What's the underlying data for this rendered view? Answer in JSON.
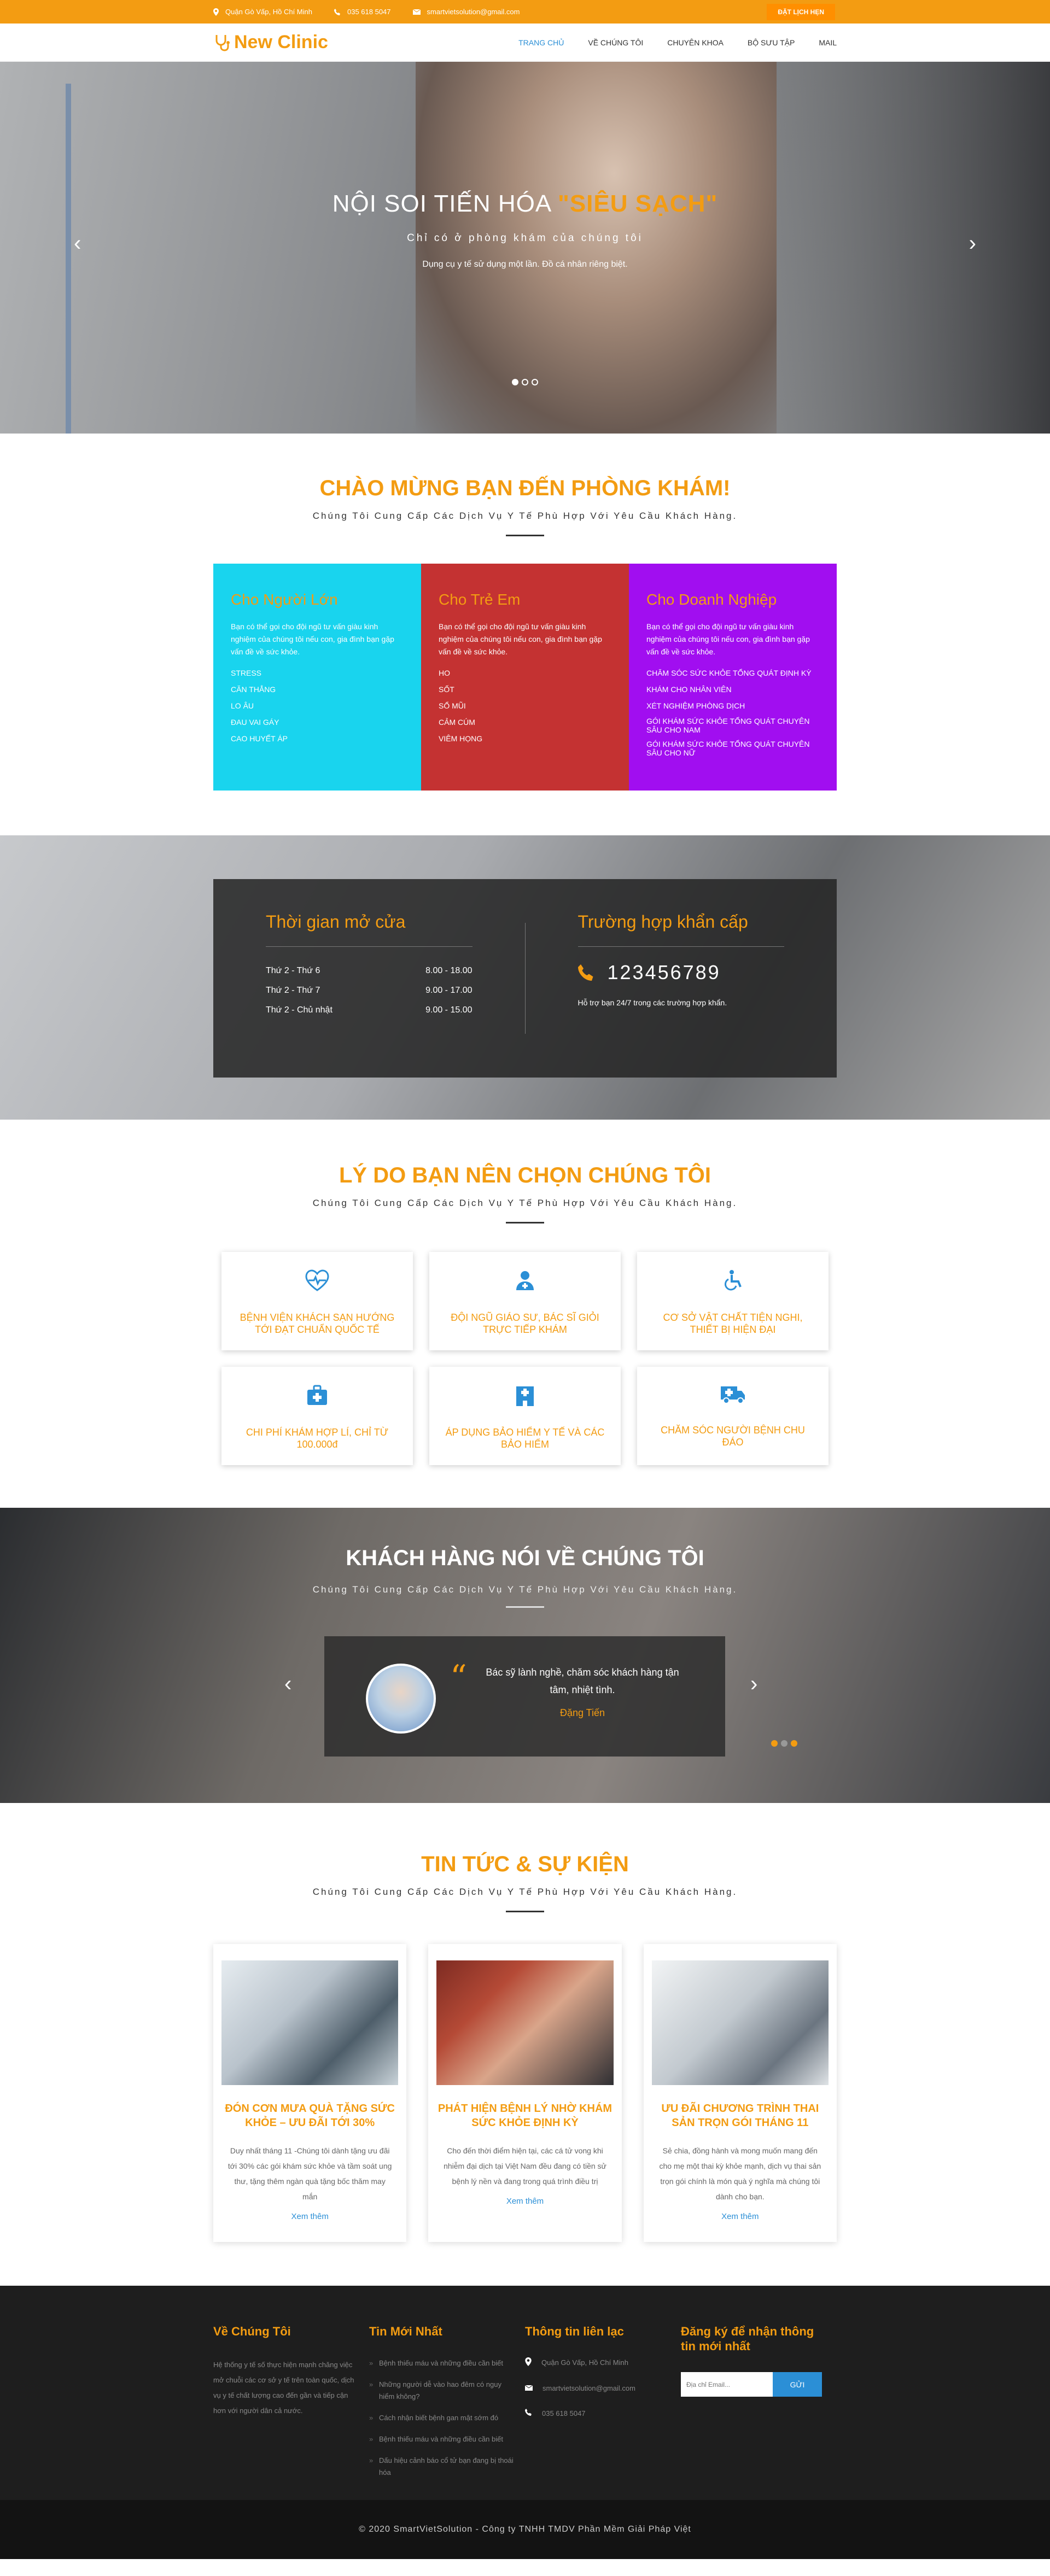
{
  "topbar": {
    "address": "Quận Gò Vấp, Hồ Chí Minh",
    "phone": "035 618 5047",
    "email": "smartvietsolution@gmail.com",
    "cta": "ĐẶT LỊCH HẸN"
  },
  "logo": {
    "text": "New Clinic"
  },
  "menu": [
    {
      "label": "TRANG CHỦ"
    },
    {
      "label": "VỀ CHÚNG TÔI"
    },
    {
      "label": "CHUYÊN KHOA"
    },
    {
      "label": "BỘ SƯU TẬP"
    },
    {
      "label": "MAIL"
    }
  ],
  "hero": {
    "title_prefix": "NỘI SOI TIẾN HÓA",
    "title_highlight": "\"SIÊU SẠCH\"",
    "subtitle": "Chỉ có ở phòng khám của chúng tôi",
    "text": "Dụng cụ y tế sử dụng một lần. Đồ cá nhân riêng biệt."
  },
  "welcome": {
    "title": "CHÀO MỪNG BẠN ĐẾN PHÒNG KHÁM!",
    "subtitle": "Chúng Tôi Cung Cấp Các Dịch Vụ Y Tế Phù Hợp Với Yêu Cầu Khách Hàng."
  },
  "services": [
    {
      "title": "Cho Người Lớn",
      "desc": "Bạn có thể gọi cho đội ngũ tư vấn giàu kinh nghiệm của chúng tôi nếu con, gia đình bạn gặp vấn đề về sức khỏe.",
      "items": [
        "STRESS",
        "CĂN THẲNG",
        "LO ÂU",
        "ĐAU VAI GÁY",
        "CAO HUYẾT ÁP"
      ],
      "color": "#19d4ee"
    },
    {
      "title": "Cho Trẻ Em",
      "desc": "Bạn có thể gọi cho đội ngũ tư vấn giàu kinh nghiệm của chúng tôi nếu con, gia đình bạn gặp vấn đề về sức khỏe.",
      "items": [
        "HO",
        "SỐT",
        "SỔ MŨI",
        "CẢM CÚM",
        "VIÊM HỌNG"
      ],
      "color": "#c43232"
    },
    {
      "title": "Cho Doanh Nghiệp",
      "desc": "Bạn có thể gọi cho đội ngũ tư vấn giàu kinh nghiệm của chúng tôi nếu con, gia đình bạn gặp vấn đề về sức khỏe.",
      "items": [
        "CHĂM SÓC SỨC KHỎE TỔNG QUÁT ĐỊNH KỲ",
        "KHÁM CHO NHÂN VIÊN",
        "XÉT NGHIỆM PHÒNG DỊCH",
        "GÓI KHÁM SỨC KHỎE TỔNG QUÁT CHUYÊN SÂU CHO NAM",
        "GÓI KHÁM SỨC KHỎE TỔNG QUÁT CHUYÊN SÂU CHO NỮ"
      ],
      "color": "#a10ef0"
    }
  ],
  "hours": {
    "title": "Thời gian mở cửa",
    "rows": [
      {
        "day": "Thứ 2 - Thứ 6",
        "time": "8.00 - 18.00"
      },
      {
        "day": "Thứ 2 - Thứ 7",
        "time": "9.00 - 17.00"
      },
      {
        "day": "Thứ 2 - Chủ nhật",
        "time": "9.00 - 15.00"
      }
    ]
  },
  "emergency": {
    "title": "Trường hợp khẩn cấp",
    "phone": "123456789",
    "note": "Hỗ trợ bạn 24/7 trong các trường hợp khẩn."
  },
  "why": {
    "title": "LÝ DO BẠN NÊN CHỌN CHÚNG TÔI",
    "subtitle": "Chúng Tôi Cung Cấp Các Dịch Vụ Y Tế Phù Hợp Với Yêu Cầu Khách Hàng.",
    "items": [
      {
        "icon": "heart-pulse-icon",
        "text": "BỆNH VIỆN KHÁCH SẠN HƯỚNG TỚI ĐẠT CHUẨN QUỐC TẾ"
      },
      {
        "icon": "doctor-icon",
        "text": "ĐỘI NGŨ GIÁO SƯ, BÁC SĨ GIỎI TRỰC TIẾP KHÁM"
      },
      {
        "icon": "wheelchair-icon",
        "text": "CƠ SỞ VẬT CHẤT TIỆN NGHI, THIẾT BỊ HIỆN ĐẠI"
      },
      {
        "icon": "medkit-icon",
        "text": "CHI PHÍ KHÁM HỢP LÍ, CHỈ TỪ 100.000đ"
      },
      {
        "icon": "hospital-icon",
        "text": "ÁP DỤNG BẢO HIỂM Y TẾ VÀ CÁC BẢO HIỂM"
      },
      {
        "icon": "ambulance-icon",
        "text": "CHĂM SÓC NGƯỜI BỆNH CHU ĐÁO"
      }
    ]
  },
  "testimonials": {
    "title": "KHÁCH HÀNG NÓI VỀ CHÚNG TÔI",
    "subtitle": "Chúng Tôi Cung Cấp Các Dịch Vụ Y Tế Phù Hợp Với Yêu Cầu Khách Hàng.",
    "quote": "Bác sỹ lành nghề, chăm sóc khách hàng tận tâm, nhiệt tình.",
    "author": "Đặng Tiến"
  },
  "news": {
    "title": "TIN TỨC & SỰ KIỆN",
    "subtitle": "Chúng Tôi Cung Cấp Các Dịch Vụ Y Tế Phù Hợp Với Yêu Cầu Khách Hàng.",
    "items": [
      {
        "title": "ĐÓN CƠN MƯA QUÀ TẶNG SỨC KHỎE – ƯU ĐÃI TỚI 30%",
        "desc": "Duy nhất tháng 11 -Chúng tôi dành tặng ưu đãi tới 30% các gói khám sức khỏe và tầm soát ung thư, tặng thêm ngàn quà tặng bốc thăm may mắn",
        "more": "Xem thêm"
      },
      {
        "title": "PHÁT HIỆN BỆNH LÝ NHỜ KHÁM SỨC KHỎE ĐỊNH KỲ",
        "desc": "Cho đến thời điểm hiện tại, các cá tử vong khi nhiễm đại dịch tại Việt Nam đều đang có tiền sử bệnh lý nền và đang trong quá trình điều trị",
        "more": "Xem thêm"
      },
      {
        "title": "ƯU ĐÃI CHƯƠNG TRÌNH THAI SẢN TRỌN GÓI THÁNG 11",
        "desc": "Sẻ chia, đồng hành và mong muốn mang đến cho mẹ một thai kỳ khỏe mạnh, dịch vụ thai sản trọn gói chính là món quà ý nghĩa mà chúng tôi dành cho bạn.",
        "more": "Xem thêm"
      }
    ]
  },
  "footer": {
    "about_title": "Về Chúng Tôi",
    "about_text": "Hệ thống y tế số thực hiện mạnh chăng việc mở chuỗi các cơ sở y tế trên toàn quốc, dịch vụ y tế chất lượng cao đến gần và tiếp cận hơn với người dân cả nước.",
    "recent_title": "Tin Mới Nhất",
    "recent": [
      "Bệnh thiếu máu và những điều cần biết",
      "Những người dễ vào hao đêm có nguy hiểm không?",
      "Cách nhận biết bệnh gan mật sớm đó",
      "Bệnh thiếu máu và những điều cần biết",
      "Dấu hiệu cảnh báo cổ tử bạn đang bị thoái hóa"
    ],
    "contact_title": "Thông tin liên lạc",
    "address": "Quận Gò Vấp, Hồ Chí Minh",
    "email": "smartvietsolution@gmail.com",
    "phone": "035 618 5047",
    "subscribe_title": "Đăng ký để nhận thông tin mới nhất",
    "email_placeholder": "Địa chỉ Email...",
    "send": "GỬI",
    "copyright": "© 2020 SmartVietSolution - Công ty TNHH TMDV Phần Mềm Giải Pháp Việt"
  }
}
